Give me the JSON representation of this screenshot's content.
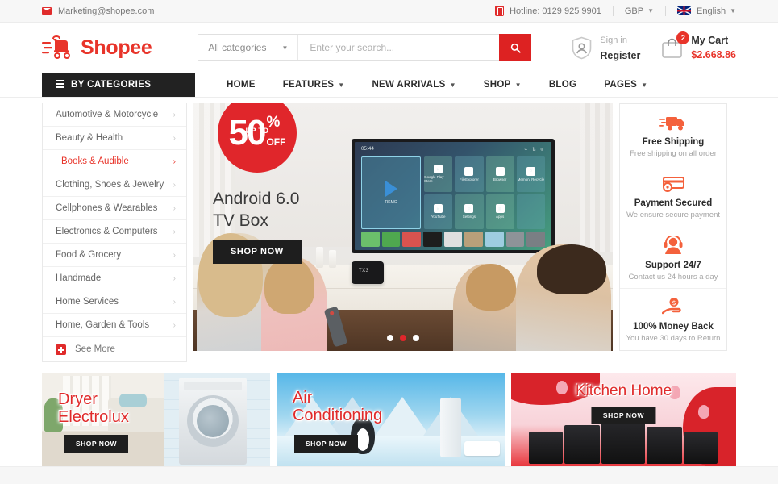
{
  "topbar": {
    "email": "Marketing@shopee.com",
    "email_icon": "mail-icon",
    "hotline": "Hotline: 0129 925 9901",
    "hotline_icon": "phone-icon",
    "currency": "GBP",
    "language": "English",
    "flag_icon": "uk-flag-icon"
  },
  "header": {
    "logo_text": "Shopee",
    "logo_icon": "shopping-cart-logo-icon",
    "category_select": "All categories",
    "search_placeholder": "Enter your search...",
    "search_value": "",
    "search_icon": "search-icon",
    "account": {
      "icon": "user-shield-icon",
      "signin": "Sign in",
      "register": "Register"
    },
    "cart": {
      "icon": "cart-bag-icon",
      "badge": "2",
      "label": "My Cart",
      "total": "$2.668.86"
    }
  },
  "nav": {
    "by_categories": "BY CATEGORIES",
    "by_categories_icon": "list-icon",
    "menu": [
      {
        "label": "HOME",
        "has_caret": false
      },
      {
        "label": "FEATURES",
        "has_caret": true
      },
      {
        "label": "NEW ARRIVALS",
        "has_caret": true
      },
      {
        "label": "SHOP",
        "has_caret": true
      },
      {
        "label": "BLOG",
        "has_caret": false
      },
      {
        "label": "PAGES",
        "has_caret": true
      }
    ]
  },
  "sidebar": {
    "items": [
      {
        "label": "Automotive & Motorcycle",
        "active": false
      },
      {
        "label": "Beauty & Health",
        "active": false
      },
      {
        "label": "Books & Audible",
        "active": true
      },
      {
        "label": "Clothing, Shoes & Jewelry",
        "active": false
      },
      {
        "label": "Cellphones & Wearables",
        "active": false
      },
      {
        "label": "Electronics & Computers",
        "active": false
      },
      {
        "label": "Food & Grocery",
        "active": false
      },
      {
        "label": "Handmade",
        "active": false
      },
      {
        "label": "Home Services",
        "active": false
      },
      {
        "label": "Home, Garden & Tools",
        "active": false
      }
    ],
    "see_more": "See More",
    "see_more_icon": "plus-box-icon"
  },
  "hero": {
    "badge_number": "50",
    "badge_percent": "%",
    "badge_upto": "UP TO",
    "badge_off": "OFF",
    "title_line1": "Android 6.0",
    "title_line2": "TV Box",
    "button": "SHOP NOW",
    "tv_time": "05:44",
    "tv_box_label": "TX3",
    "tv_tiles": [
      "Google Play Store",
      "FileExplorer",
      "Browser",
      "Memory Recycle",
      "YouTube",
      "Settings",
      "Apps"
    ],
    "tv_player_label": "RKMC",
    "dots": [
      {
        "active": false
      },
      {
        "active": true
      },
      {
        "active": false
      }
    ]
  },
  "services": [
    {
      "icon": "truck-icon",
      "title": "Free Shipping",
      "subtitle": "Free shipping on all order"
    },
    {
      "icon": "credit-card-icon",
      "title": "Payment Secured",
      "subtitle": "We ensure secure payment"
    },
    {
      "icon": "headset-support-icon",
      "title": "Support 24/7",
      "subtitle": "Contact us 24 hours a day"
    },
    {
      "icon": "money-back-hand-icon",
      "title": "100% Money Back",
      "subtitle": "You have 30 days to Return"
    }
  ],
  "promos": [
    {
      "title_line1": "Dryer",
      "title_line2": "Electrolux",
      "button": "SHOP NOW"
    },
    {
      "title_line1": "Air",
      "title_line2": "Conditioning",
      "button": "SHOP NOW"
    },
    {
      "title_line1": "Kitchen Home",
      "title_line2": "",
      "button": "SHOP NOW"
    }
  ],
  "colors": {
    "brand_red": "#e8342a",
    "button_red": "#dd2222",
    "accent_orange": "#f4613c",
    "dark": "#222222"
  }
}
